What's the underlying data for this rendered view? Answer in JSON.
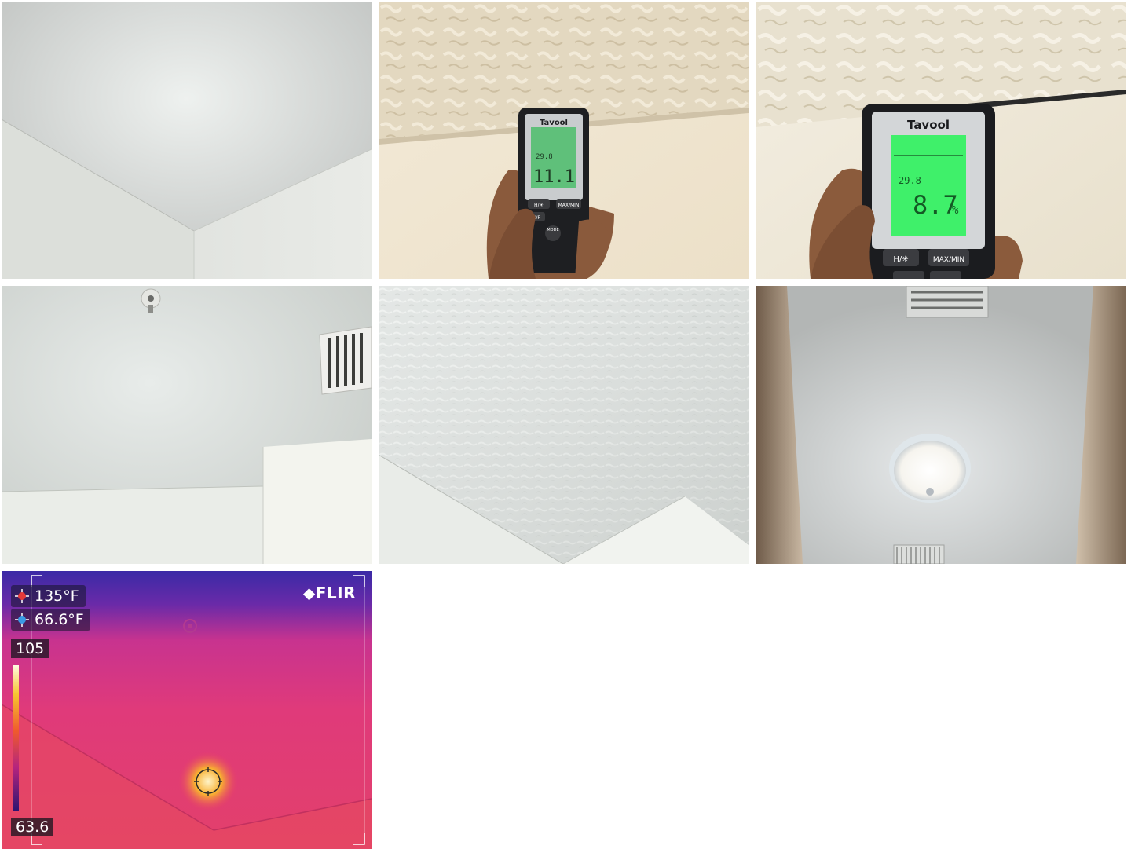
{
  "photos": [
    {
      "id": "ceiling-corner-1"
    },
    {
      "id": "moisture-meter-close"
    },
    {
      "id": "moisture-meter-reading"
    },
    {
      "id": "ceiling-vent-sprinkler"
    },
    {
      "id": "ceiling-textured"
    },
    {
      "id": "ceiling-light-hallway"
    },
    {
      "id": "thermal-image"
    }
  ],
  "meter_small": {
    "brand": "Tavool",
    "temp": "29.8",
    "reading": "11.1",
    "btn_hold": "H/☀",
    "btn_maxmin": "MAX/MIN",
    "btn_cf": "C/F",
    "btn_mode": "MODE"
  },
  "meter_large": {
    "brand": "Tavool",
    "temp": "29.8",
    "reading": "8.7",
    "unit": "%",
    "btn_hold": "H/✳",
    "btn_maxmin": "MAX/MIN"
  },
  "thermal": {
    "logo": "FLIR",
    "max_temp": "135°F",
    "min_temp": "66.6°F",
    "scale_high": "105",
    "scale_low": "63.6",
    "colors": {
      "hot": "#ff2a6d",
      "cold": "#3b2ca0",
      "mid": "#d92e8f"
    }
  }
}
